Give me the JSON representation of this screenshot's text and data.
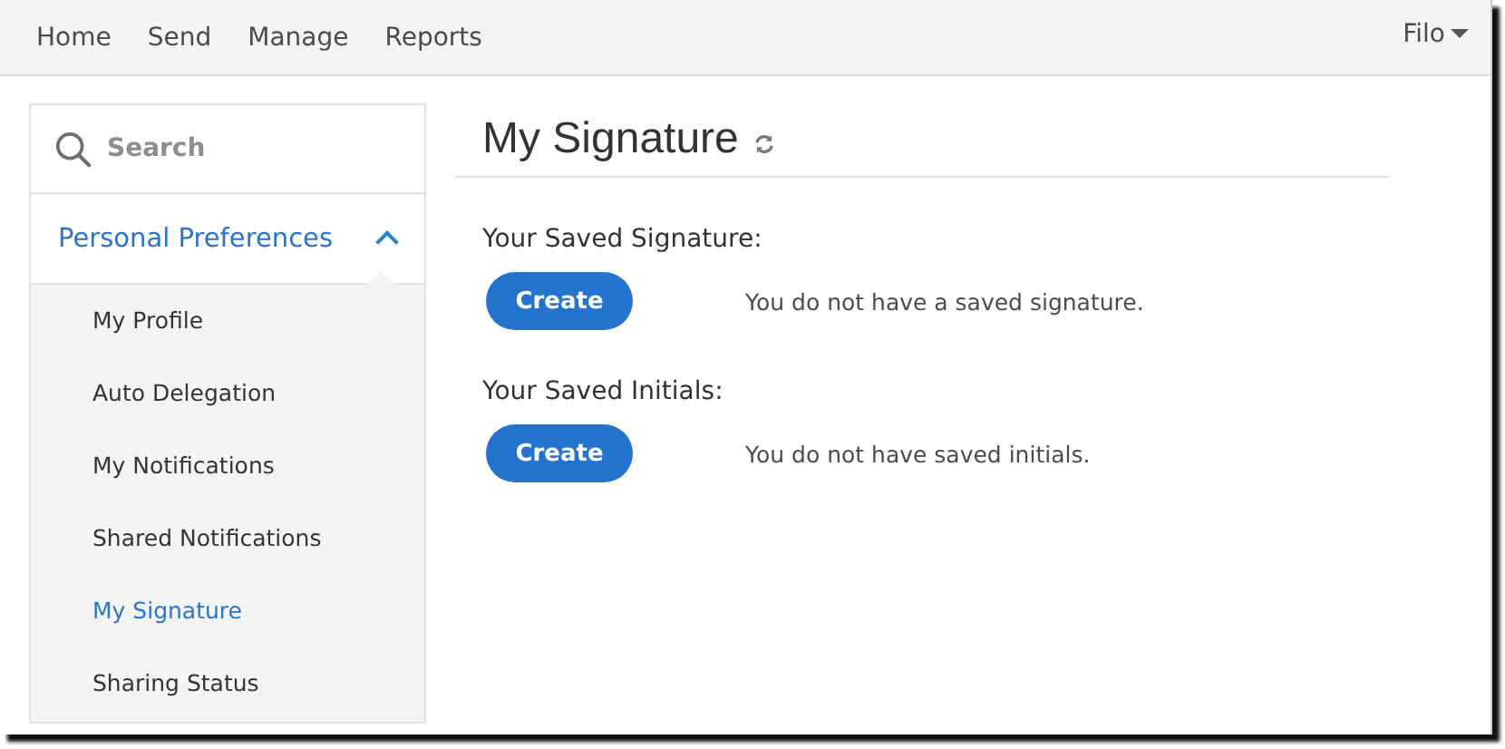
{
  "nav": {
    "items": [
      {
        "label": "Home"
      },
      {
        "label": "Send"
      },
      {
        "label": "Manage"
      },
      {
        "label": "Reports"
      }
    ],
    "user": "Filo"
  },
  "sidebar": {
    "search": {
      "placeholder": "Search"
    },
    "section": {
      "label": "Personal Preferences",
      "expanded": true
    },
    "items": [
      {
        "label": "My Profile",
        "selected": false
      },
      {
        "label": "Auto Delegation",
        "selected": false
      },
      {
        "label": "My Notifications",
        "selected": false
      },
      {
        "label": "Shared Notifications",
        "selected": false
      },
      {
        "label": "My Signature",
        "selected": true
      },
      {
        "label": "Sharing Status",
        "selected": false
      }
    ]
  },
  "main": {
    "title": "My Signature",
    "sections": [
      {
        "heading": "Your Saved Signature:",
        "button": "Create",
        "message": "You do not have a saved signature."
      },
      {
        "heading": "Your Saved Initials:",
        "button": "Create",
        "message": "You do not have saved initials."
      }
    ]
  }
}
